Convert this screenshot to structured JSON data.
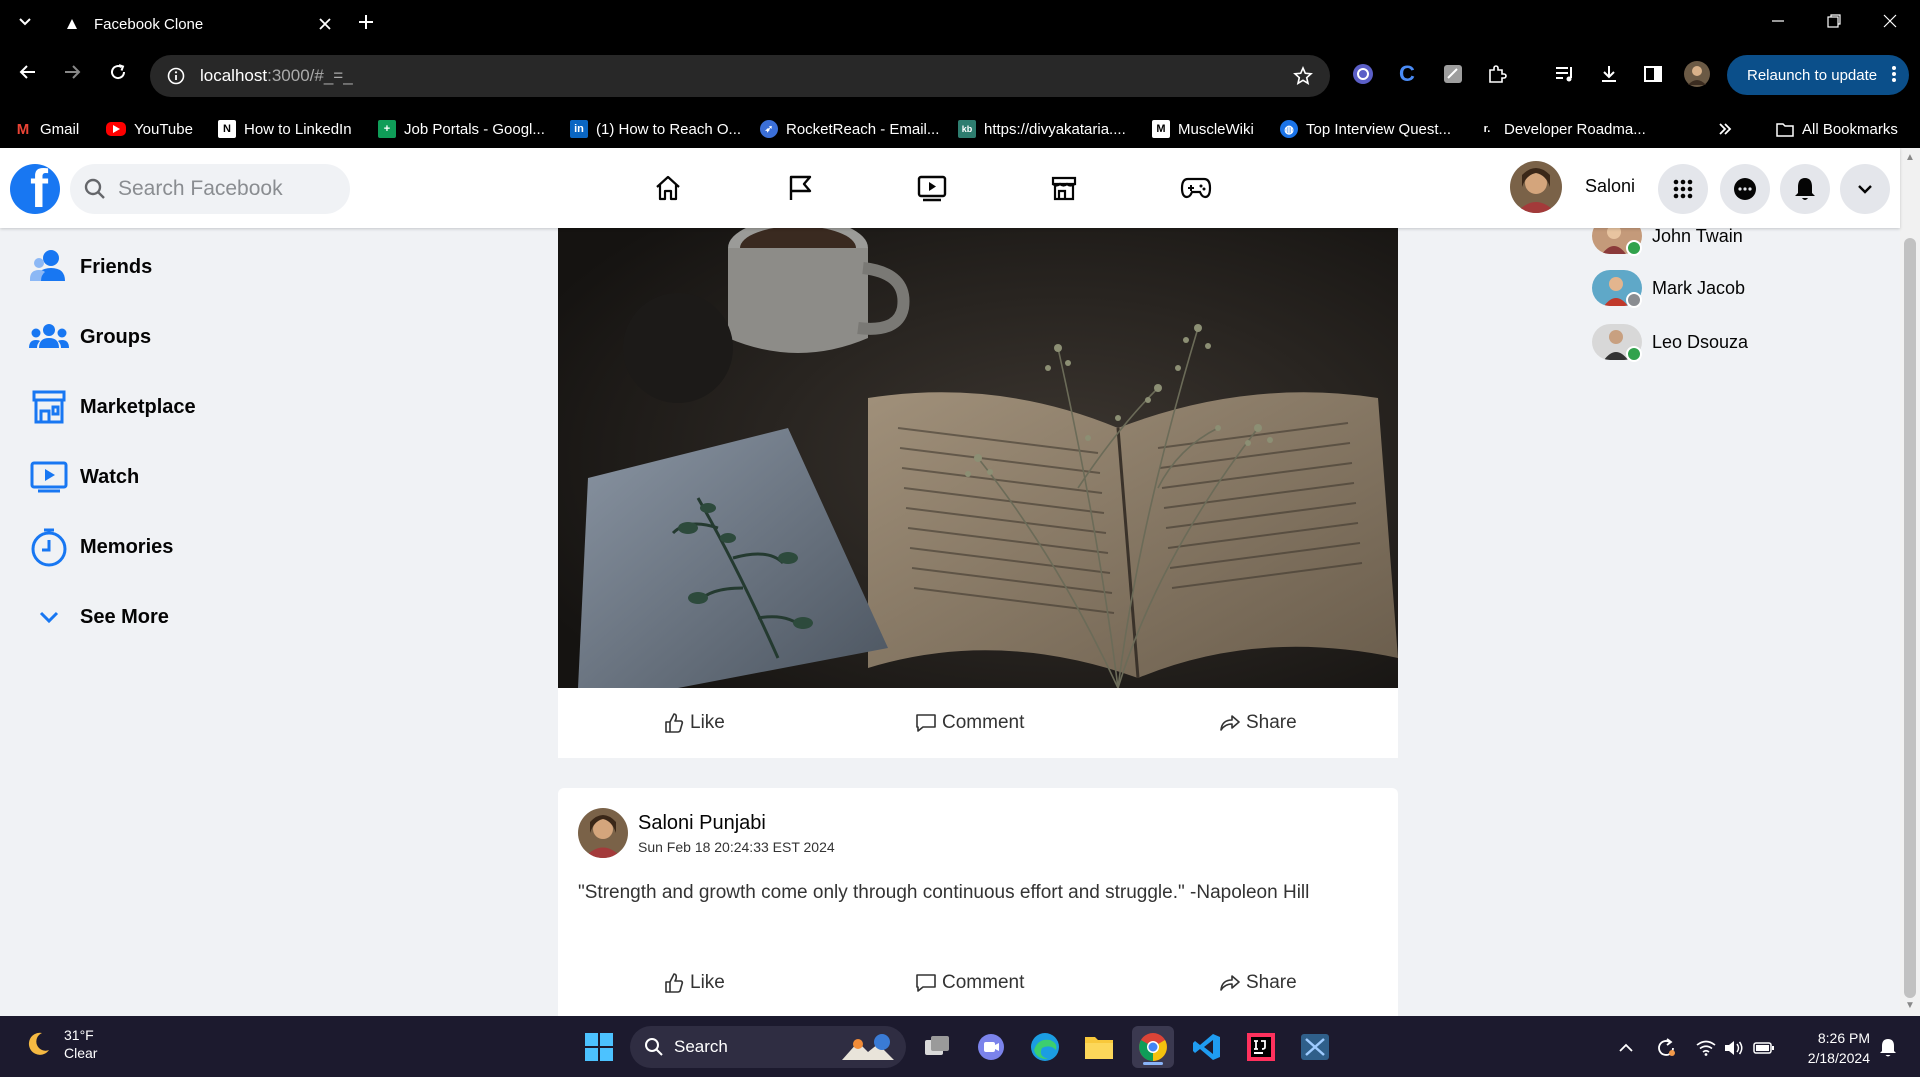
{
  "browser": {
    "tab_title": "Facebook Clone",
    "url_host": "localhost",
    "url_rest": ":3000/#_=_",
    "relaunch_label": "Relaunch to update",
    "bookmarks": [
      {
        "label": "Gmail",
        "icon": "gmail-icon",
        "color": "#ea4335"
      },
      {
        "label": "YouTube",
        "icon": "youtube-icon",
        "color": "#ff0000"
      },
      {
        "label": "How to LinkedIn",
        "icon": "notion-icon",
        "color": "#ffffff"
      },
      {
        "label": "Job Portals - Googl...",
        "icon": "sheets-icon",
        "color": "#0f9d58"
      },
      {
        "label": "(1) How to Reach O...",
        "icon": "linkedin-icon",
        "color": "#0a66c2"
      },
      {
        "label": "RocketReach - Email...",
        "icon": "rocket-icon",
        "color": "#ffffff"
      },
      {
        "label": "https://divyakataria....",
        "icon": "kb-icon",
        "color": "#2e7d6f"
      },
      {
        "label": "MuscleWiki",
        "icon": "musclewiki-icon",
        "color": "#ffffff"
      },
      {
        "label": "Top Interview Quest...",
        "icon": "globe-icon",
        "color": "#1a73e8"
      },
      {
        "label": "Developer Roadma...",
        "icon": "roadmap-icon",
        "color": "#ffffff"
      }
    ],
    "all_bookmarks_label": "All Bookmarks"
  },
  "facebook": {
    "search_placeholder": "Search Facebook",
    "user_name": "Saloni",
    "sidebar": [
      {
        "label": "Friends",
        "icon": "friends-icon"
      },
      {
        "label": "Groups",
        "icon": "groups-icon"
      },
      {
        "label": "Marketplace",
        "icon": "marketplace-icon"
      },
      {
        "label": "Watch",
        "icon": "watch-icon"
      },
      {
        "label": "Memories",
        "icon": "memories-icon"
      },
      {
        "label": "See More",
        "icon": "chevron-down-icon"
      }
    ],
    "actions": {
      "like": "Like",
      "comment": "Comment",
      "share": "Share"
    },
    "post": {
      "author": "Saloni Punjabi",
      "date": "Sun Feb 18 20:24:33 EST 2024",
      "text": "\"Strength and growth come only through continuous effort and struggle.\" -Napoleon Hill"
    },
    "contacts": [
      {
        "name": "John Twain",
        "status_color": "#31a24c"
      },
      {
        "name": "Mark Jacob",
        "status_color": "#8a8d91"
      },
      {
        "name": "Leo Dsouza",
        "status_color": "#31a24c"
      }
    ],
    "brand_color": "#1877f2"
  },
  "taskbar": {
    "temperature": "31°F",
    "condition": "Clear",
    "search_label": "Search",
    "time": "8:26 PM",
    "date": "2/18/2024"
  }
}
